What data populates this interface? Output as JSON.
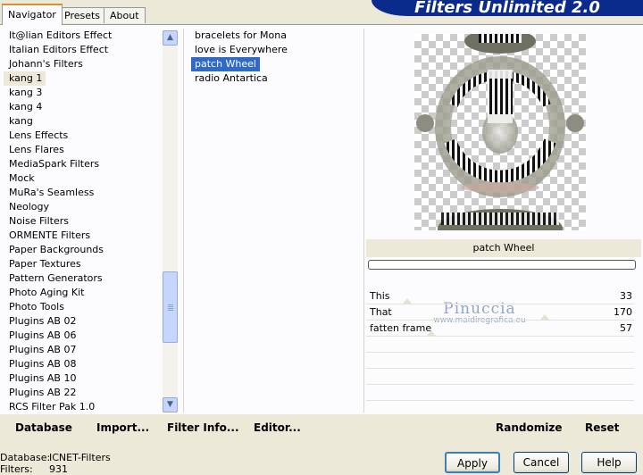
{
  "tabs": [
    {
      "label": "Navigator"
    },
    {
      "label": "Presets"
    },
    {
      "label": "About"
    }
  ],
  "banner": {
    "title": "Filters Unlimited 2.0"
  },
  "categories": [
    "It@lian Editors Effect",
    "Italian Editors Effect",
    "Johann's Filters",
    "kang 1",
    "kang 3",
    "kang 4",
    "kang",
    "Lens Effects",
    "Lens Flares",
    "MediaSpark Filters",
    "Mock",
    "MuRa's Seamless",
    "Neology",
    "Noise Filters",
    "ORMENTE Filters",
    "Paper Backgrounds",
    "Paper Textures",
    "Pattern Generators",
    "Photo Aging Kit",
    "Photo Tools",
    "Plugins AB 02",
    "Plugins AB 06",
    "Plugins AB 07",
    "Plugins AB 08",
    "Plugins AB 10",
    "Plugins AB 22",
    "RCS Filter Pak 1.0"
  ],
  "selected_category": "kang 1",
  "filters": [
    "bracelets for Mona",
    "love is Everywhere",
    "patch Wheel",
    "radio Antartica"
  ],
  "selected_filter": "patch Wheel",
  "preview": {
    "filter_name": "patch Wheel"
  },
  "sliders": [
    {
      "label": "This",
      "value": "33",
      "level": 33
    },
    {
      "label": "That",
      "value": "170",
      "level": 170
    },
    {
      "label": "fatten frame",
      "value": "57",
      "level": 57
    }
  ],
  "watermark": {
    "name": "Pinuccia",
    "url": "www.maidiregrafica.eu"
  },
  "actions": {
    "database": "Database",
    "import": "Import...",
    "filter_info": "Filter Info...",
    "editor": "Editor...",
    "randomize": "Randomize",
    "reset": "Reset"
  },
  "status": {
    "database_label": "Database:",
    "database_value": "ICNET-Filters",
    "filters_label": "Filters:",
    "filters_value": "931"
  },
  "buttons": {
    "apply": "Apply",
    "cancel": "Cancel",
    "help": "Help"
  },
  "colors": {
    "accent": "#316ac5",
    "banner": "#0a2a8c",
    "tab_highlight": "#e68b2c"
  }
}
